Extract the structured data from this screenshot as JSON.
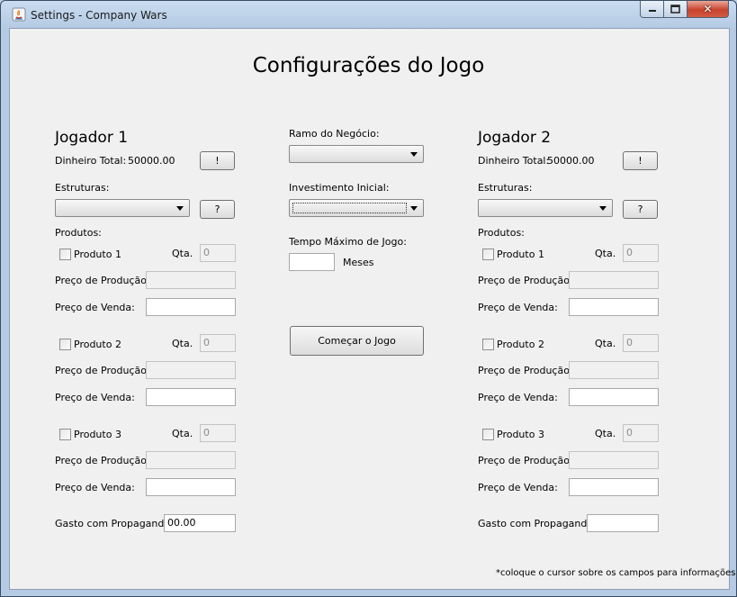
{
  "window": {
    "title": "Settings - Company Wars",
    "close_glyph": "✕"
  },
  "main_title": "Configurações do Jogo",
  "player1": {
    "title": "Jogador 1",
    "money_label": "Dinheiro Total:",
    "money_value": "50000.00",
    "info_button": "!",
    "structures_label": "Estruturas:",
    "structures_help_button": "?",
    "products_label": "Produtos:",
    "products": [
      {
        "name": "Produto 1",
        "qty_label": "Qta.",
        "qty": "0",
        "cost_label": "Preço de Produção:",
        "price_label": "Preço de Venda:"
      },
      {
        "name": "Produto 2",
        "qty_label": "Qta.",
        "qty": "0",
        "cost_label": "Preço de Produção:",
        "price_label": "Preço de Venda:"
      },
      {
        "name": "Produto 3",
        "qty_label": "Qta.",
        "qty": "0",
        "cost_label": "Preço de Produção:",
        "price_label": "Preço de Venda:"
      }
    ],
    "ads_label": "Gasto com Propaganda:",
    "ads_value": "00.00"
  },
  "player2": {
    "title": "Jogador 2",
    "money_label": "Dinheiro Total:",
    "money_value": "50000.00",
    "info_button": "!",
    "structures_label": "Estruturas:",
    "structures_help_button": "?",
    "products_label": "Produtos:",
    "products": [
      {
        "name": "Produto 1",
        "qty_label": "Qta.",
        "qty": "0",
        "cost_label": "Preço de Produção:",
        "price_label": "Preço de Venda:"
      },
      {
        "name": "Produto 2",
        "qty_label": "Qta.",
        "qty": "0",
        "cost_label": "Preço de Produção:",
        "price_label": "Preço de Venda:"
      },
      {
        "name": "Produto 3",
        "qty_label": "Qta.",
        "qty": "0",
        "cost_label": "Preço de Produção:",
        "price_label": "Preço de Venda:"
      }
    ],
    "ads_label": "Gasto com Propaganda:",
    "ads_value": ""
  },
  "center": {
    "business_label": "Ramo do Negócio:",
    "investment_label": "Investimento Inicial:",
    "time_label": "Tempo Máximo de Jogo:",
    "time_value": "",
    "months_label": "Meses",
    "start_button": "Começar o Jogo"
  },
  "footnote": "*coloque o cursor sobre os campos para informações"
}
